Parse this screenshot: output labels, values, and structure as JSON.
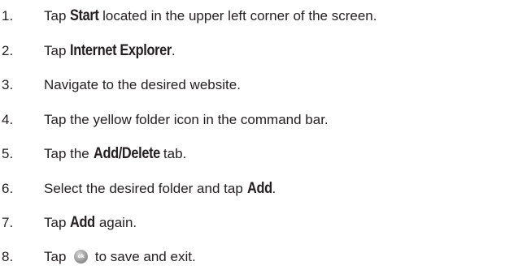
{
  "steps": [
    {
      "number": "1.",
      "parts": [
        {
          "text": "Tap ",
          "bold": false
        },
        {
          "text": "Start",
          "bold": true
        },
        {
          "text": " located in the upper left corner of the screen.",
          "bold": false
        }
      ]
    },
    {
      "number": "2.",
      "parts": [
        {
          "text": "Tap ",
          "bold": false
        },
        {
          "text": "Internet Explorer",
          "bold": true
        },
        {
          "text": ".",
          "bold": false
        }
      ]
    },
    {
      "number": "3.",
      "parts": [
        {
          "text": "Navigate to the desired website.",
          "bold": false
        }
      ]
    },
    {
      "number": "4.",
      "parts": [
        {
          "text": "Tap the yellow folder icon in the command bar.",
          "bold": false
        }
      ]
    },
    {
      "number": "5.",
      "parts": [
        {
          "text": "Tap the ",
          "bold": false
        },
        {
          "text": "Add/Delete",
          "bold": true
        },
        {
          "text": " tab.",
          "bold": false
        }
      ]
    },
    {
      "number": "6.",
      "parts": [
        {
          "text": "Select the desired folder and tap ",
          "bold": false
        },
        {
          "text": "Add",
          "bold": true
        },
        {
          "text": ".",
          "bold": false
        }
      ]
    },
    {
      "number": "7.",
      "parts": [
        {
          "text": "Tap ",
          "bold": false
        },
        {
          "text": "Add",
          "bold": true
        },
        {
          "text": " again.",
          "bold": false
        }
      ]
    },
    {
      "number": "8.",
      "parts": [
        {
          "text": "Tap ",
          "bold": false
        },
        {
          "icon": "ok-button-icon",
          "icon_label": "ok"
        },
        {
          "text": " to save and exit.",
          "bold": false
        }
      ]
    }
  ]
}
